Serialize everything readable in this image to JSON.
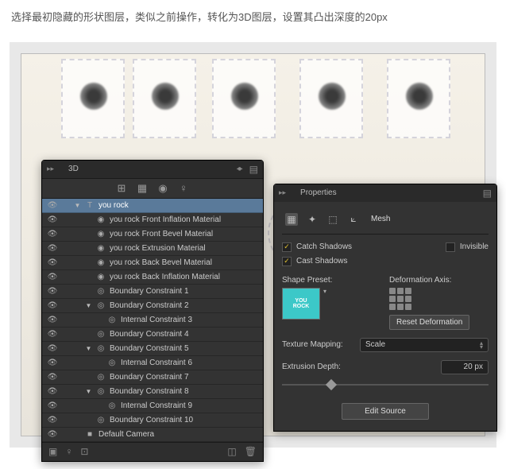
{
  "instruction": "选择最初隐藏的形状图层，类似之前操作，转化为3D图层，设置其凸出深度的20px",
  "preset_text": {
    "line1": "YOU",
    "line2": "ROCK"
  },
  "panel3d": {
    "title": "3D",
    "items": [
      {
        "label": "you rock",
        "depth": 1,
        "icon": "text",
        "twisty": "▼",
        "selected": true
      },
      {
        "label": "you rock Front Inflation Material",
        "depth": 2,
        "icon": "material"
      },
      {
        "label": "you rock Front Bevel Material",
        "depth": 2,
        "icon": "material"
      },
      {
        "label": "you rock Extrusion Material",
        "depth": 2,
        "icon": "material"
      },
      {
        "label": "you rock Back Bevel Material",
        "depth": 2,
        "icon": "material"
      },
      {
        "label": "you rock Back Inflation Material",
        "depth": 2,
        "icon": "material"
      },
      {
        "label": "Boundary Constraint 1",
        "depth": 2,
        "icon": "target"
      },
      {
        "label": "Boundary Constraint 2",
        "depth": 2,
        "icon": "target",
        "twisty": "▼"
      },
      {
        "label": "Internal Constraint 3",
        "depth": 3,
        "icon": "target"
      },
      {
        "label": "Boundary Constraint 4",
        "depth": 2,
        "icon": "target"
      },
      {
        "label": "Boundary Constraint 5",
        "depth": 2,
        "icon": "target",
        "twisty": "▼"
      },
      {
        "label": "Internal Constraint 6",
        "depth": 3,
        "icon": "target"
      },
      {
        "label": "Boundary Constraint 7",
        "depth": 2,
        "icon": "target"
      },
      {
        "label": "Boundary Constraint 8",
        "depth": 2,
        "icon": "target",
        "twisty": "▼"
      },
      {
        "label": "Internal Constraint 9",
        "depth": 3,
        "icon": "target"
      },
      {
        "label": "Boundary Constraint 10",
        "depth": 2,
        "icon": "target"
      },
      {
        "label": "Default Camera",
        "depth": 1,
        "icon": "camera"
      }
    ]
  },
  "props": {
    "title": "Properties",
    "mesh_tab": "Mesh",
    "catch_shadows": "Catch Shadows",
    "invisible": "Invisible",
    "cast_shadows": "Cast Shadows",
    "shape_preset": "Shape Preset:",
    "deformation_axis": "Deformation Axis:",
    "reset_deformation": "Reset Deformation",
    "texture_mapping": "Texture Mapping:",
    "texture_mapping_value": "Scale",
    "extrusion_depth": "Extrusion Depth:",
    "extrusion_value": "20 px",
    "edit_source": "Edit Source"
  }
}
